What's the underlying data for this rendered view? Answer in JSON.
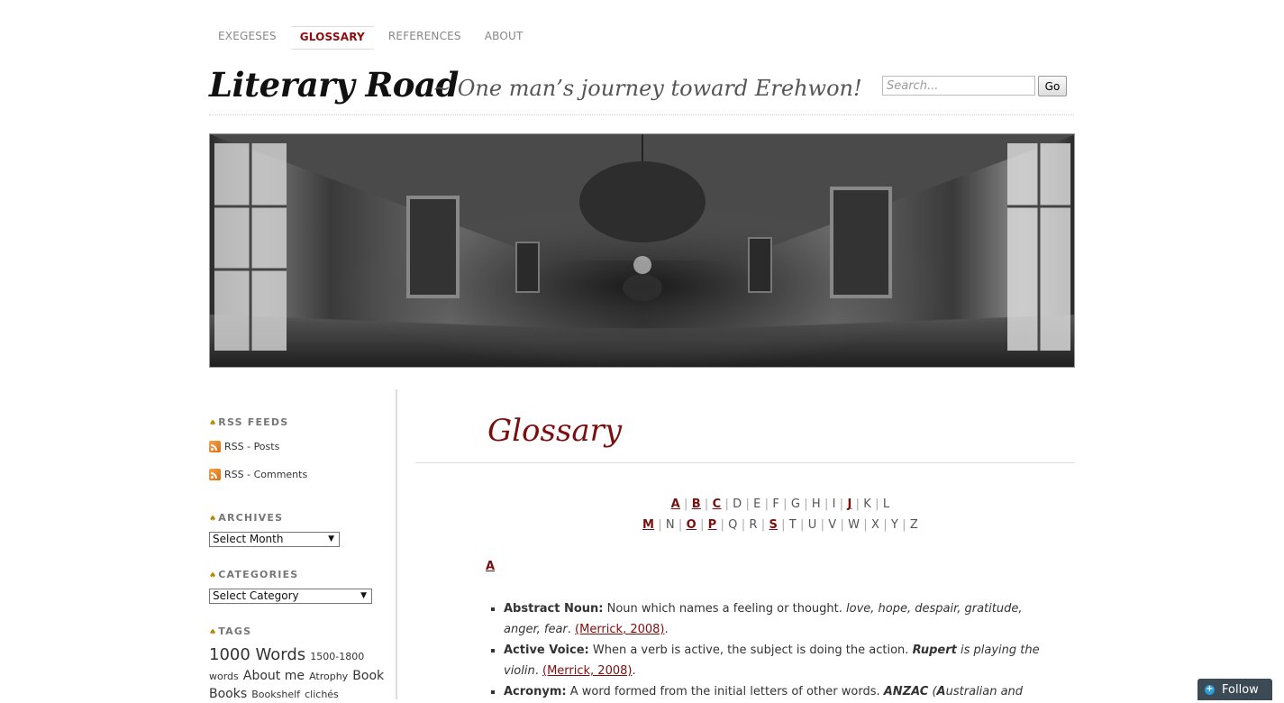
{
  "nav": [
    "EXEGESES",
    "GLOSSARY",
    "REFERENCES",
    "ABOUT"
  ],
  "header": {
    "title": "Literary Road",
    "tagline": "~ One man’s journey toward Erehwon!"
  },
  "search": {
    "placeholder": "Search...",
    "button": "Go"
  },
  "sidebar": {
    "rss_title": "RSS FEEDS",
    "rss_posts": "RSS - Posts",
    "rss_comments": "RSS - Comments",
    "archives_title": "ARCHIVES",
    "archives_select": "Select Month",
    "categories_title": "CATEGORIES",
    "categories_select": "Select Category",
    "tags_title": "TAGS",
    "tags": [
      "1000 Words",
      "1500-1800 words",
      "About me",
      "Atrophy",
      "Book",
      "Books",
      "Bookshelf",
      "clichés"
    ]
  },
  "main": {
    "title": "Glossary",
    "letters_row1": [
      "A",
      "B",
      "C",
      "D",
      "E",
      "F",
      "G",
      "H",
      "I",
      "J",
      "K",
      "L"
    ],
    "letters_row2": [
      "M",
      "N",
      "O",
      "P",
      "Q",
      "R",
      "S",
      "T",
      "U",
      "V",
      "W",
      "X",
      "Y",
      "Z"
    ],
    "linked_letters": [
      "A",
      "B",
      "C",
      "J",
      "M",
      "O",
      "P",
      "S"
    ],
    "section": "A",
    "entries": [
      {
        "term": "Abstract Noun:",
        "def": " Noun which names a feeling or thought. ",
        "example": "love, hope, despair, gratitude, anger, fear",
        "ref": "(Merrick, 2008)"
      },
      {
        "term": "Active Voice:",
        "def": " When a verb is active, the subject is doing the action. ",
        "example_bold": "Rupert",
        "example": " is playing the violin",
        "ref": "(Merrick, 2008)"
      },
      {
        "term": "Acronym:",
        "def": " A word formed from the initial letters of other words. ",
        "example_bold": "ANZAC",
        "example": " (",
        "example_bold2": "A",
        "example_tail": "ustralian and"
      }
    ]
  },
  "follow": "Follow",
  "colors": {
    "accent": "#7a0f0f",
    "follow_bg": "#3c4a55"
  }
}
